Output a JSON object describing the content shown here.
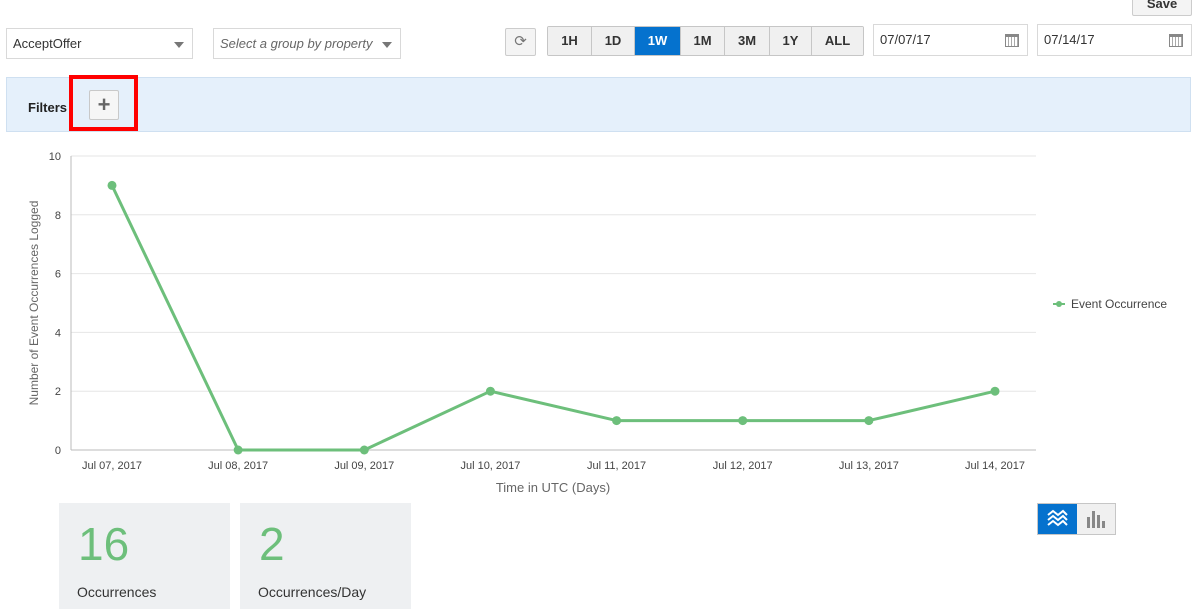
{
  "toolbar": {
    "save_label": "Save",
    "event_select_value": "AcceptOffer",
    "group_select_placeholder": "Select a group by property",
    "ranges": [
      "1H",
      "1D",
      "1W",
      "1M",
      "3M",
      "1Y",
      "ALL"
    ],
    "active_range": "1W",
    "date_from": "07/07/17",
    "date_to": "07/14/17"
  },
  "filters": {
    "label": "Filters",
    "add_symbol": "+"
  },
  "chart_data": {
    "type": "line",
    "categories": [
      "Jul 07, 2017",
      "Jul 08, 2017",
      "Jul 09, 2017",
      "Jul 10, 2017",
      "Jul 11, 2017",
      "Jul 12, 2017",
      "Jul 13, 2017",
      "Jul 14, 2017"
    ],
    "series": [
      {
        "name": "Event Occurrence",
        "values": [
          9,
          0,
          0,
          2,
          1,
          1,
          1,
          2
        ],
        "color": "#6dbf7b"
      }
    ],
    "yticks": [
      0,
      2,
      4,
      6,
      8,
      10
    ],
    "ylim": [
      0,
      10
    ],
    "xlabel": "Time in UTC (Days)",
    "ylabel": "Number of Event Occurrences Logged",
    "grid": true,
    "legend_position": "right"
  },
  "stats": [
    {
      "value": "16",
      "label": "Occurrences"
    },
    {
      "value": "2",
      "label": "Occurrences/Day"
    }
  ],
  "view_toggle": {
    "active": "line-icon",
    "inactive": "bar-chart-icon"
  },
  "colors": {
    "accent": "#0572ce",
    "series": "#6dbf7b",
    "highlight": "#ff0000"
  }
}
